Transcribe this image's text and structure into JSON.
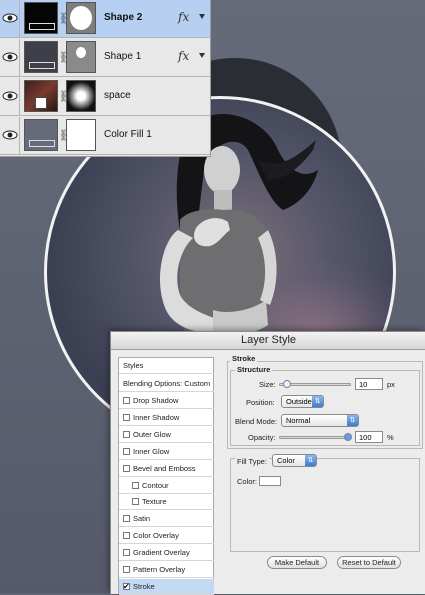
{
  "layers": [
    {
      "name": "Shape 2",
      "selected": true,
      "bold": true,
      "fx": "fx",
      "thumb": "black",
      "mask": "circle-large"
    },
    {
      "name": "Shape 1",
      "selected": false,
      "bold": false,
      "fx": "fx",
      "thumb": "dark",
      "mask": "circle-small"
    },
    {
      "name": "space",
      "selected": false,
      "bold": false,
      "fx": "",
      "thumb": "space",
      "mask": "radial"
    },
    {
      "name": "Color Fill 1",
      "selected": false,
      "bold": false,
      "fx": "",
      "thumb": "slate",
      "mask": "white"
    }
  ],
  "dialog": {
    "title": "Layer Style",
    "styles_header": "Styles",
    "blending_header": "Blending Options: Custom",
    "effects": [
      {
        "label": "Drop Shadow",
        "checked": false,
        "indent": false
      },
      {
        "label": "Inner Shadow",
        "checked": false,
        "indent": false
      },
      {
        "label": "Outer Glow",
        "checked": false,
        "indent": false
      },
      {
        "label": "Inner Glow",
        "checked": false,
        "indent": false
      },
      {
        "label": "Bevel and Emboss",
        "checked": false,
        "indent": false
      },
      {
        "label": "Contour",
        "checked": false,
        "indent": true
      },
      {
        "label": "Texture",
        "checked": false,
        "indent": true
      },
      {
        "label": "Satin",
        "checked": false,
        "indent": false
      },
      {
        "label": "Color Overlay",
        "checked": false,
        "indent": false
      },
      {
        "label": "Gradient Overlay",
        "checked": false,
        "indent": false
      },
      {
        "label": "Pattern Overlay",
        "checked": false,
        "indent": false
      },
      {
        "label": "Stroke",
        "checked": true,
        "indent": false,
        "selected": true
      }
    ],
    "stroke": {
      "section_title": "Stroke",
      "structure_title": "Structure",
      "size_label": "Size:",
      "size_value": "10",
      "size_unit": "px",
      "size_level": 0.04,
      "position_label": "Position:",
      "position_value": "Outside",
      "blend_label": "Blend Mode:",
      "blend_value": "Normal",
      "opacity_label": "Opacity:",
      "opacity_value": "100",
      "opacity_unit": "%",
      "opacity_level": 1.0,
      "fill_type_label": "Fill Type:",
      "fill_type_value": "Color",
      "color_label": "Color:",
      "stroke_color": "#ffffff"
    },
    "make_default": "Make Default",
    "reset_default": "Reset to Default"
  }
}
